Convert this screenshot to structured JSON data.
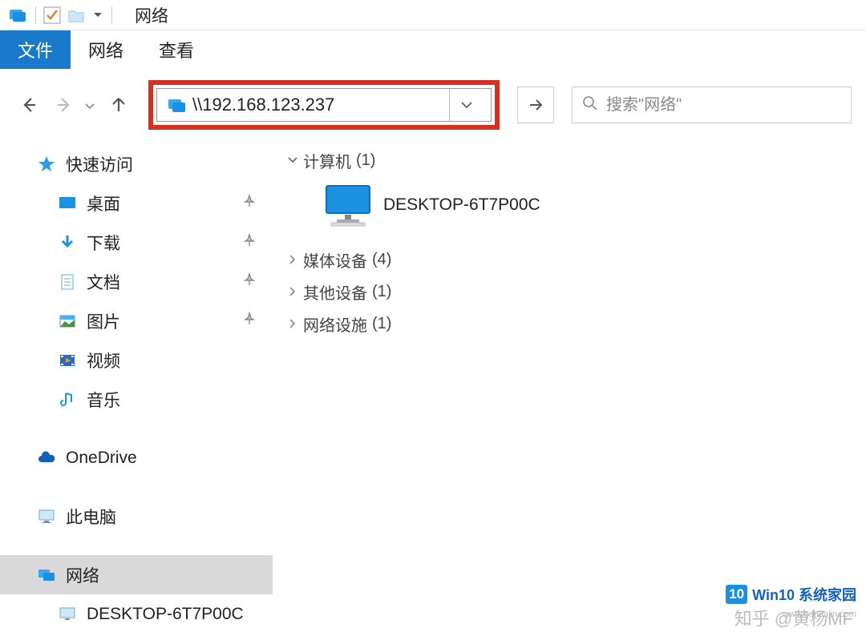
{
  "title": "网络",
  "ribbon": {
    "file": "文件",
    "network": "网络",
    "view": "查看"
  },
  "address": {
    "value": "\\\\192.168.123.237"
  },
  "search": {
    "placeholder": "搜索\"网络\""
  },
  "sidebar": {
    "quick": "快速访问",
    "desktop": "桌面",
    "downloads": "下载",
    "documents": "文档",
    "pictures": "图片",
    "videos": "视频",
    "music": "音乐",
    "onedrive": "OneDrive",
    "thispc": "此电脑",
    "network": "网络",
    "netchild": "DESKTOP-6T7P00C"
  },
  "content": {
    "computers": {
      "label": "计算机",
      "count": "(1)"
    },
    "device_name": "DESKTOP-6T7P00C",
    "media": {
      "label": "媒体设备",
      "count": "(4)"
    },
    "other": {
      "label": "其他设备",
      "count": "(1)"
    },
    "infra": {
      "label": "网络设施",
      "count": "(1)"
    }
  },
  "watermarks": {
    "zhihu": "知乎 @黄杨MF",
    "brand": "Win10 系统家园",
    "url": "www.qdhuajin.com"
  }
}
